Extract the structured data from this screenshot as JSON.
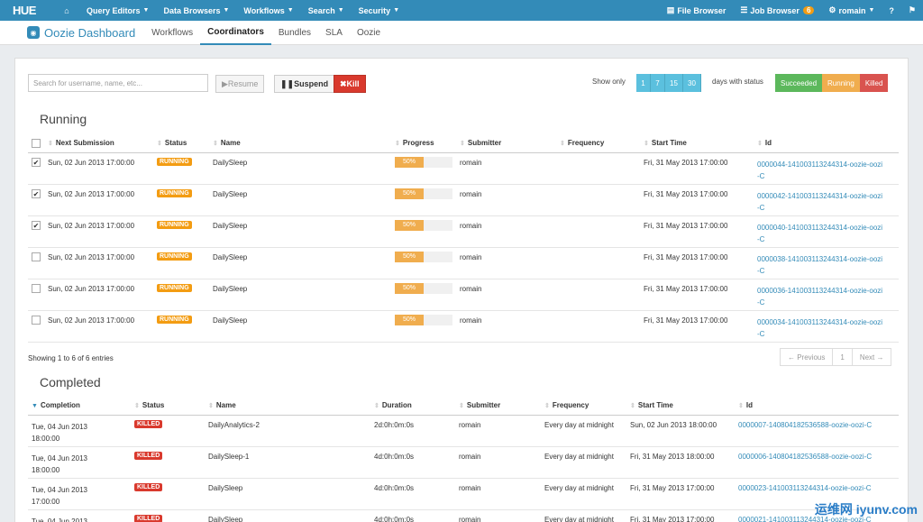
{
  "topnav": {
    "logo": "HUE",
    "items": [
      {
        "label": "Query Editors"
      },
      {
        "label": "Data Browsers"
      },
      {
        "label": "Workflows"
      },
      {
        "label": "Search"
      },
      {
        "label": "Security"
      }
    ],
    "file_browser": "File Browser",
    "job_browser": "Job Browser",
    "job_count": "6",
    "user": "romain"
  },
  "subnav": {
    "title": "Oozie Dashboard",
    "tabs": [
      "Workflows",
      "Coordinators",
      "Bundles",
      "SLA",
      "Oozie"
    ],
    "active": "Coordinators"
  },
  "toolbar": {
    "search_placeholder": "Search for username, name, etc...",
    "resume": "Resume",
    "suspend": "Suspend",
    "kill": "Kill",
    "show_only": "Show only",
    "days": [
      "1",
      "7",
      "15",
      "30"
    ],
    "days_with_status": "days with status",
    "statuses": [
      "Succeeded",
      "Running",
      "Killed"
    ]
  },
  "running": {
    "title": "Running",
    "headers": [
      "Next Submission",
      "Status",
      "Name",
      "Progress",
      "Submitter",
      "Frequency",
      "Start Time",
      "Id"
    ],
    "rows": [
      {
        "checked": true,
        "next": "Sun, 02 Jun 2013 17:00:00",
        "status": "RUNNING",
        "name": "DailySleep",
        "progress": "50%",
        "progress_value": 0.5,
        "submitter": "romain",
        "frequency": "",
        "start": "Fri, 31 May 2013 17:00:00",
        "id": "0000044-141003113244314-oozie-oozi-C"
      },
      {
        "checked": true,
        "next": "Sun, 02 Jun 2013 17:00:00",
        "status": "RUNNING",
        "name": "DailySleep",
        "progress": "50%",
        "progress_value": 0.5,
        "submitter": "romain",
        "frequency": "",
        "start": "Fri, 31 May 2013 17:00:00",
        "id": "0000042-141003113244314-oozie-oozi-C"
      },
      {
        "checked": true,
        "next": "Sun, 02 Jun 2013 17:00:00",
        "status": "RUNNING",
        "name": "DailySleep",
        "progress": "50%",
        "progress_value": 0.5,
        "submitter": "romain",
        "frequency": "",
        "start": "Fri, 31 May 2013 17:00:00",
        "id": "0000040-141003113244314-oozie-oozi-C"
      },
      {
        "checked": false,
        "next": "Sun, 02 Jun 2013 17:00:00",
        "status": "RUNNING",
        "name": "DailySleep",
        "progress": "50%",
        "progress_value": 0.5,
        "submitter": "romain",
        "frequency": "",
        "start": "Fri, 31 May 2013 17:00:00",
        "id": "0000038-141003113244314-oozie-oozi-C"
      },
      {
        "checked": false,
        "next": "Sun, 02 Jun 2013 17:00:00",
        "status": "RUNNING",
        "name": "DailySleep",
        "progress": "50%",
        "progress_value": 0.5,
        "submitter": "romain",
        "frequency": "",
        "start": "Fri, 31 May 2013 17:00:00",
        "id": "0000036-141003113244314-oozie-oozi-C"
      },
      {
        "checked": false,
        "next": "Sun, 02 Jun 2013 17:00:00",
        "status": "RUNNING",
        "name": "DailySleep",
        "progress": "50%",
        "progress_value": 0.5,
        "submitter": "romain",
        "frequency": "",
        "start": "Fri, 31 May 2013 17:00:00",
        "id": "0000034-141003113244314-oozie-oozi-C"
      }
    ],
    "showing": "Showing 1 to 6 of 6 entries",
    "pager": {
      "prev": "← Previous",
      "page": "1",
      "next": "Next →"
    }
  },
  "completed": {
    "title": "Completed",
    "headers": [
      "Completion",
      "Status",
      "Name",
      "Duration",
      "Submitter",
      "Frequency",
      "Start Time",
      "Id"
    ],
    "rows": [
      {
        "completion": "Tue, 04 Jun 2013 18:00:00",
        "status": "KILLED",
        "name": "DailyAnalytics-2",
        "duration": "2d:0h:0m:0s",
        "submitter": "romain",
        "frequency": "Every day at midnight",
        "start": "Sun, 02 Jun 2013 18:00:00",
        "id": "0000007-140804182536588-oozie-oozi-C"
      },
      {
        "completion": "Tue, 04 Jun 2013 18:00:00",
        "status": "KILLED",
        "name": "DailySleep-1",
        "duration": "4d:0h:0m:0s",
        "submitter": "romain",
        "frequency": "Every day at midnight",
        "start": "Fri, 31 May 2013 18:00:00",
        "id": "0000006-140804182536588-oozie-oozi-C"
      },
      {
        "completion": "Tue, 04 Jun 2013 17:00:00",
        "status": "KILLED",
        "name": "DailySleep",
        "duration": "4d:0h:0m:0s",
        "submitter": "romain",
        "frequency": "Every day at midnight",
        "start": "Fri, 31 May 2013 17:00:00",
        "id": "0000023-141003113244314-oozie-oozi-C"
      },
      {
        "completion": "Tue, 04 Jun 2013",
        "status": "KILLED",
        "name": "DailySleep",
        "duration": "4d:0h:0m:0s",
        "submitter": "romain",
        "frequency": "Every day at midnight",
        "start": "Fri, 31 May 2013 17:00:00",
        "id": "0000021-141003113244314-oozie-oozi-C"
      }
    ]
  },
  "watermark": "运维网 iyunv.com",
  "colors": {
    "accent": "#338bb8",
    "running": "#f39c12",
    "killed": "#d9392d",
    "succeeded": "#5cb85c"
  }
}
